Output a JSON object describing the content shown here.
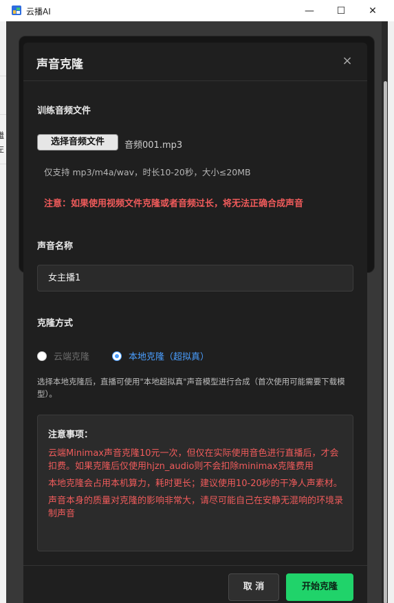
{
  "window": {
    "title": "云播AI",
    "minimize": "—",
    "maximize": "☐",
    "close": "✕"
  },
  "background": {
    "left_chars": [
      "繼",
      "左"
    ]
  },
  "dialog": {
    "title": "声音克隆",
    "close": "×",
    "training": {
      "label": "训练音频文件",
      "button": "选择音频文件",
      "file_name": "音频001.mp3",
      "hint": "仅支持 mp3/m4a/wav，时长10-20秒，大小≤20MB",
      "warning": "注意：如果使用视频文件克隆或者音频过长，将无法正确合成声音"
    },
    "voice_name": {
      "label": "声音名称",
      "value": "女主播1"
    },
    "clone_method": {
      "label": "克隆方式",
      "options": [
        {
          "label": "云端克隆",
          "selected": false
        },
        {
          "label": "本地克隆（超拟真）",
          "selected": true
        }
      ],
      "description": "选择本地克隆后，直播可使用\"本地超拟真\"声音模型进行合成（首次使用可能需要下载模型）。"
    },
    "notice": {
      "title": "注意事项：",
      "items": [
        "云端Minimax声音克隆10元一次，但仅在实际使用音色进行直播后，才会扣费。如果克隆后仅使用hjzn_audio则不会扣除minimax克隆费用",
        "本地克隆会占用本机算力，耗时更长；建议使用10-20秒的干净人声素材。",
        "声音本身的质量对克隆的影响非常大，请尽可能自己在安静无混响的环境录制声音"
      ]
    },
    "footer": {
      "cancel": "取 消",
      "start": "开始克隆"
    }
  },
  "colors": {
    "accent_blue": "#4a9eff",
    "warning_red": "#f05b5b",
    "start_green": "#20d36a",
    "dialog_bg": "#1f1f1f"
  }
}
